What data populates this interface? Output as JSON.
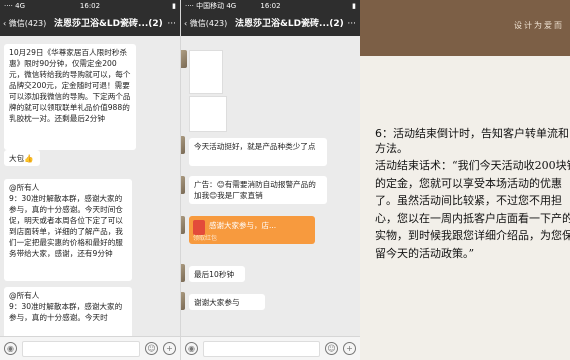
{
  "panel1": {
    "status": {
      "carrier": "···· 4G",
      "time": "16:02",
      "battery": "▮"
    },
    "nav": {
      "back": "‹ 微信(423)",
      "title": "法恩莎卫浴&LD瓷砖...(2)",
      "more": "···"
    },
    "messages": [
      "10月29日《华尊家居百人限时秒杀惠》限时90分钟，仅需定金200元，微信转给我的导购就可以，每个品牌交200元，定金随时可退！需要可以添加我微信的导购。下定两个品牌的就可以领取联单礼品价值988的乳胶枕一对。还剩最后2分钟",
      "大包👍",
      "@所有人\n9：30准时解散本群，感谢大家的参与，真的十分感谢。今天时间仓促，明天或者本周各位下定了可以到店面转单，详细的了解产品，我们一定把最实惠的价格和最好的服务带给大家，感谢，还有9分钟",
      "@所有人\n9：30准时解散本群，感谢大家的参与，真的十分感谢。今天时"
    ]
  },
  "panel2": {
    "status": {
      "carrier": "···· 中国移动 4G",
      "time": "16:02",
      "battery": "▮"
    },
    "nav": {
      "back": "‹ 微信(423)",
      "title": "法恩莎卫浴&LD瓷砖...(2)",
      "more": "···"
    },
    "messages": [
      "今天活动挺好，就是产品种类少了点",
      "广告：😊有需要消防自动报警产品的加我😊我是厂家直销",
      "最后10秒钟",
      "谢谢大家参与"
    ],
    "redpacket": {
      "text": "感谢大家参与，店...",
      "sub": "领取红包"
    }
  },
  "panel3": {
    "band_text": "设计为爱而",
    "heading": "6：活动结束倒计时，告知客户转单流和方法。",
    "paragraph": "活动结束话术：“我们今天活动收200块钱的定金，您就可以享受本场活动的优惠了。虽然活动间比较紧，不过您不用担心，您以在一周内抵客户店面看一下产的实物，到时候我跟您详细介绍品，为您保留今天的活动政策。”"
  },
  "colors": {
    "nav": "#2e2e2e",
    "chat_bg": "#ebebeb",
    "band": "#7c5f46",
    "redpacket": "#f79a3e"
  }
}
